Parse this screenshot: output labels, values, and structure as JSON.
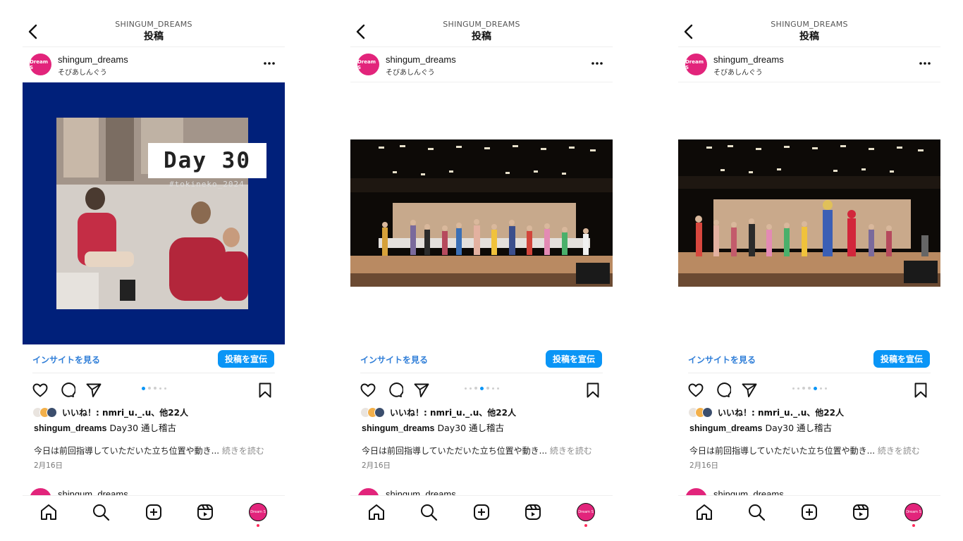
{
  "screens": [
    {
      "header": {
        "account": "SHINGUM_DREAMS",
        "title": "投稿"
      },
      "post": {
        "username": "shingum_dreams",
        "location": "そびあしんぐう",
        "avatar_text": "Dream S",
        "media": {
          "type": "title-card",
          "badge": "Day 30",
          "hashtag": "#tokineko_2024"
        },
        "insight_link": "インサイトを見る",
        "promote_button": "投稿を宣伝",
        "carousel": {
          "count": 5,
          "active": 0
        },
        "likes": "いいね！: nmri_u._.u、他22人",
        "caption_user": "shingum_dreams",
        "caption_text": "Day30 通し稽古",
        "body": "今日は前回指導していただいた立ち位置や動き...",
        "read_more": "続きを読む",
        "date": "2月16日",
        "next_username": "shingum_dreams"
      },
      "nav": {
        "profile_text": "Dream S"
      }
    },
    {
      "header": {
        "account": "SHINGUM_DREAMS",
        "title": "投稿"
      },
      "post": {
        "username": "shingum_dreams",
        "location": "そびあしんぐう",
        "avatar_text": "Dream S",
        "media": {
          "type": "stage-photo"
        },
        "insight_link": "インサイトを見る",
        "promote_button": "投稿を宣伝",
        "carousel": {
          "count": 7,
          "active": 3
        },
        "likes": "いいね！: nmri_u._.u、他22人",
        "caption_user": "shingum_dreams",
        "caption_text": "Day30 通し稽古",
        "body": "今日は前回指導していただいた立ち位置や動き...",
        "read_more": "続きを読む",
        "date": "2月16日",
        "next_username": "shingum_dreams"
      },
      "nav": {
        "profile_text": "Dream S"
      }
    },
    {
      "header": {
        "account": "SHINGUM_DREAMS",
        "title": "投稿"
      },
      "post": {
        "username": "shingum_dreams",
        "location": "そびあしんぐう",
        "avatar_text": "Dream S",
        "media": {
          "type": "stage-photo"
        },
        "insight_link": "インサイトを見る",
        "promote_button": "投稿を宣伝",
        "carousel": {
          "count": 7,
          "active": 4
        },
        "likes": "いいね！: nmri_u._.u、他22人",
        "caption_user": "shingum_dreams",
        "caption_text": "Day30 通し稽古",
        "body": "今日は前回指導していただいた立ち位置や動き...",
        "read_more": "続きを読む",
        "date": "2月16日",
        "next_username": "shingum_dreams"
      },
      "nav": {
        "profile_text": "Dream S"
      }
    }
  ],
  "icons": {
    "back": "chevron-left-icon",
    "more": "more-horizontal-icon",
    "like": "heart-icon",
    "comment": "comment-bubble-icon",
    "share": "paper-plane-icon",
    "save": "bookmark-icon",
    "home": "home-icon",
    "search": "search-icon",
    "create": "plus-square-icon",
    "reels": "reels-icon"
  },
  "colors": {
    "brand_pink": "#e2247b",
    "link_blue": "#2f7ed8",
    "button_blue": "#0a95f6",
    "card_navy": "#00207a",
    "notification_red": "#ff2b5a"
  }
}
